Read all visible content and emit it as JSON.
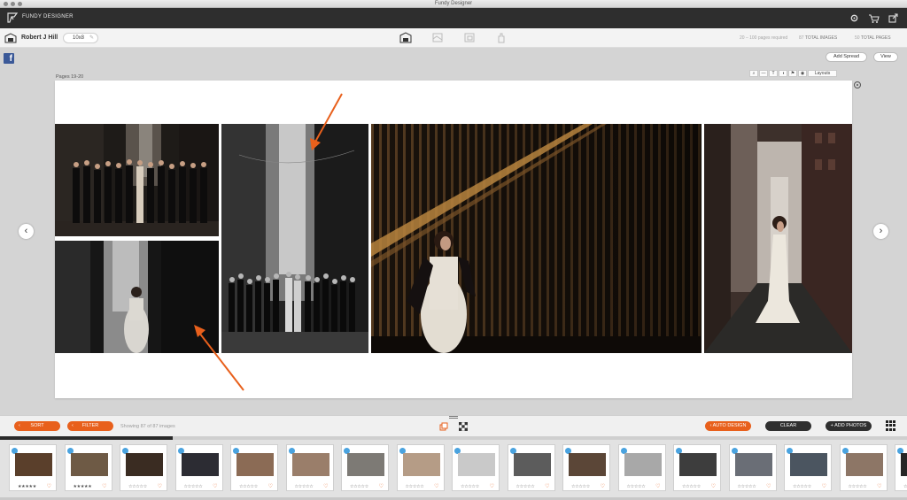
{
  "window": {
    "title": "Fundy Designer"
  },
  "app": {
    "name": "FUNDY DESIGNER"
  },
  "project": {
    "name": "Robert J Hill",
    "size": "10x8",
    "pages_required": "20 – 100 pages required",
    "total_images_count": "87",
    "total_images_label": "TOTAL IMAGES",
    "total_pages_count": "50",
    "total_pages_label": "TOTAL PAGES"
  },
  "workspace": {
    "add_spread": "Add Spread",
    "view": "View",
    "pages_label": "Pages 19-20",
    "layouts": "Layouts",
    "tool_glyphs": [
      "⌕",
      "—",
      "T",
      "◑",
      "⚑",
      "◉"
    ]
  },
  "bottom": {
    "sort": "SORT",
    "filter": "FILTER",
    "showing": "Showing 87 of 87 images",
    "auto_design": "AUTO DESIGN",
    "clear": "CLEAR",
    "add_photos": "+ ADD PHOTOS"
  },
  "filmstrip": {
    "stars": "★★★★★",
    "empty_stars": "☆☆☆☆☆",
    "heart": "♡",
    "progress": 0.19,
    "thumbs": [
      {
        "tone": "#5a3f2b"
      },
      {
        "tone": "#6e5a45"
      },
      {
        "tone": "#3a2c22"
      },
      {
        "tone": "#2c2c33"
      },
      {
        "tone": "#8b6b55"
      },
      {
        "tone": "#9a7e6a"
      },
      {
        "tone": "#7d7a75"
      },
      {
        "tone": "#b59c86"
      },
      {
        "tone": "#c9c9c9"
      },
      {
        "tone": "#5c5c5c"
      },
      {
        "tone": "#5b4637"
      },
      {
        "tone": "#a8a8a8"
      },
      {
        "tone": "#3d3d3d"
      },
      {
        "tone": "#6a6e76"
      },
      {
        "tone": "#4b5560"
      },
      {
        "tone": "#8d7666"
      },
      {
        "tone": "#262626"
      }
    ]
  },
  "colors": {
    "accent": "#e8601c",
    "arrow": "#e8601c",
    "dark": "#2e2e2e"
  }
}
